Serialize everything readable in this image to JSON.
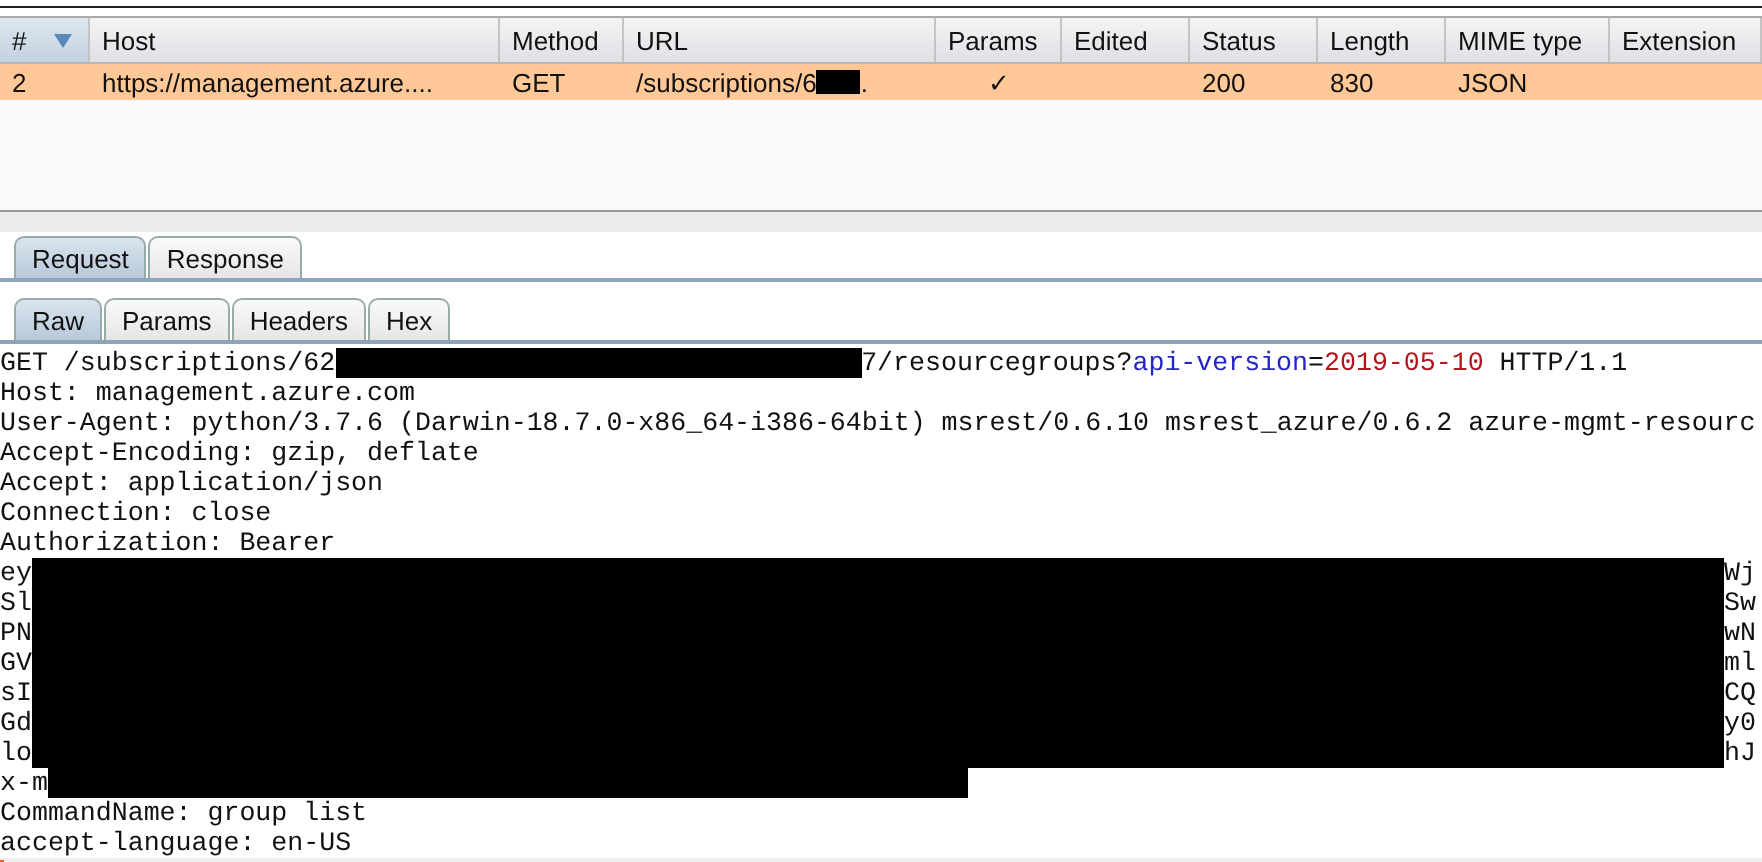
{
  "table": {
    "columns": [
      {
        "label": "#",
        "sorted": true
      },
      {
        "label": "Host",
        "sorted": false
      },
      {
        "label": "Method",
        "sorted": false
      },
      {
        "label": "URL",
        "sorted": false
      },
      {
        "label": "Params",
        "sorted": false
      },
      {
        "label": "Edited",
        "sorted": false
      },
      {
        "label": "Status",
        "sorted": false
      },
      {
        "label": "Length",
        "sorted": false
      },
      {
        "label": "MIME type",
        "sorted": false
      },
      {
        "label": "Extension",
        "sorted": false
      }
    ],
    "rows": [
      {
        "selected": true,
        "number": "2",
        "host": "https://management.azure....",
        "method": "GET",
        "url": "/subscriptions/6",
        "url_tail": ".",
        "params": "✓",
        "status": "200",
        "length": "830",
        "mime_type": "JSON"
      }
    ]
  },
  "message_tabs": [
    {
      "label": "Request",
      "selected": true
    },
    {
      "label": "Response",
      "selected": false
    }
  ],
  "view_tabs": [
    {
      "label": "Raw",
      "selected": true
    },
    {
      "label": "Params",
      "selected": false
    },
    {
      "label": "Headers",
      "selected": false
    },
    {
      "label": "Hex",
      "selected": false
    }
  ],
  "request_lines": [
    {
      "kind": "request",
      "segments": [
        {
          "kind": "text",
          "text": "GET /subscriptions/62"
        },
        {
          "kind": "redaction"
        },
        {
          "kind": "text",
          "text": "7/resourcegroups?"
        },
        {
          "kind": "param-name",
          "text": "api-version"
        },
        {
          "kind": "text",
          "text": "="
        },
        {
          "kind": "param-value",
          "text": "2019-05-10"
        },
        {
          "kind": "text",
          "text": " HTTP/1.1"
        }
      ]
    },
    {
      "kind": "plain",
      "text": "Host: management.azure.com"
    },
    {
      "kind": "plain",
      "text": "User-Agent: python/3.7.6 (Darwin-18.7.0-x86_64-i386-64bit) msrest/0.6.10 msrest_azure/0.6.2 azure-mgmt-resourc"
    },
    {
      "kind": "plain",
      "text": "Accept-Encoding: gzip, deflate"
    },
    {
      "kind": "plain",
      "text": "Accept: application/json"
    },
    {
      "kind": "plain",
      "text": "Connection: close"
    },
    {
      "kind": "plain",
      "text": "Authorization: Bearer"
    },
    {
      "kind": "redacted",
      "start": "ey",
      "end": "Wj"
    },
    {
      "kind": "redacted",
      "start": "Sl",
      "end": "Sw"
    },
    {
      "kind": "redacted",
      "start": "PN",
      "end": "wN"
    },
    {
      "kind": "redacted",
      "start": "GV",
      "end": "ml"
    },
    {
      "kind": "redacted",
      "start": "sI",
      "end": "CQ"
    },
    {
      "kind": "redacted",
      "start": "Gd",
      "end": "y0"
    },
    {
      "kind": "redacted",
      "start": "lo",
      "end": "hJ"
    },
    {
      "kind": "redacted",
      "start": "x-m"
    },
    {
      "kind": "plain",
      "text": "CommandName: group list"
    },
    {
      "kind": "plain",
      "text": "accept-language: en-US"
    }
  ]
}
